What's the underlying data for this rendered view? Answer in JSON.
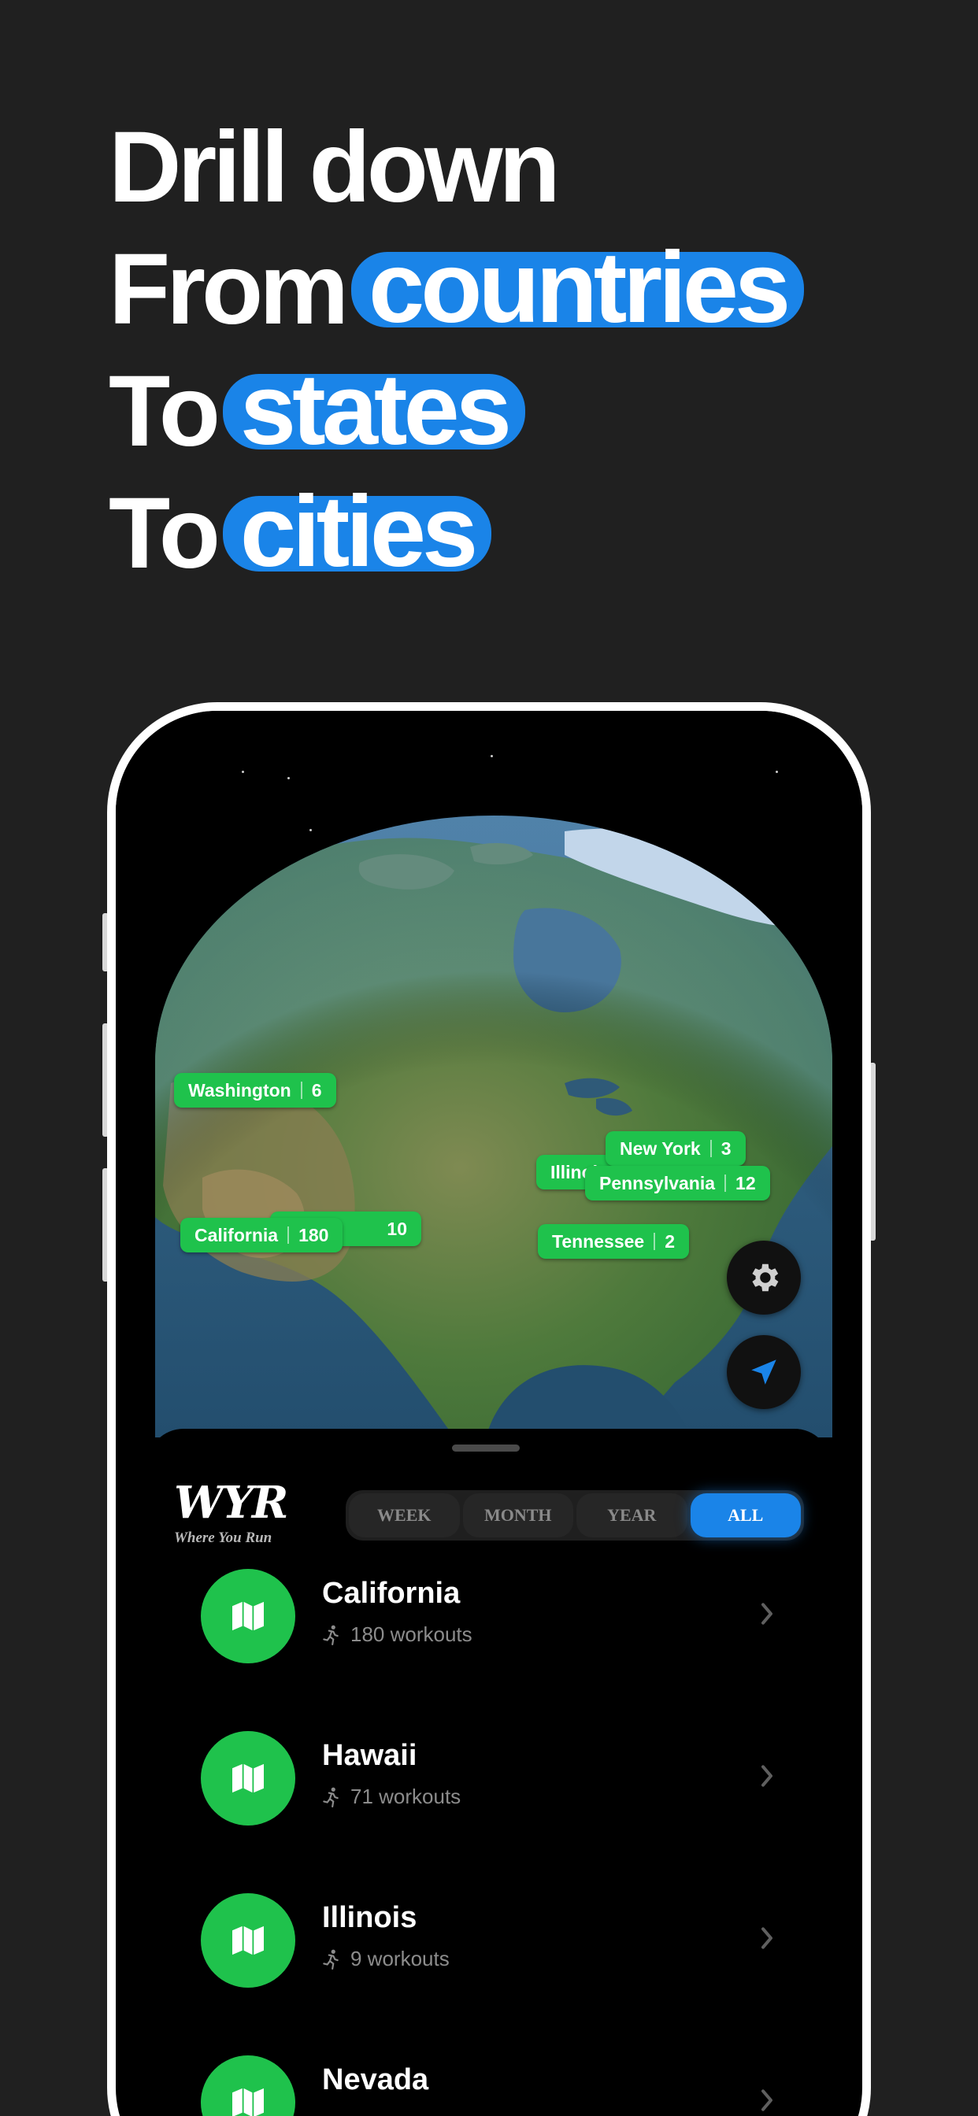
{
  "headline": {
    "line1": "Drill down",
    "line2_prefix": "From",
    "line2_highlight": "countries",
    "line3_prefix": "To",
    "line3_highlight": "states",
    "line4_prefix": "To",
    "line4_highlight": "cities"
  },
  "map_tags": [
    {
      "name": "Washington",
      "count": "6"
    },
    {
      "name": "New York",
      "count": "3"
    },
    {
      "name": "Illinois",
      "count": ""
    },
    {
      "name": "Pennsylvania",
      "count": "12"
    },
    {
      "name": "California",
      "count": "180"
    },
    {
      "name": "",
      "count": "10"
    },
    {
      "name": "Tennessee",
      "count": "2"
    }
  ],
  "app": {
    "logo": "WYR",
    "logo_subtitle": "Where You Run"
  },
  "filter": {
    "options": [
      "WEEK",
      "MONTH",
      "YEAR",
      "ALL"
    ],
    "selected": "ALL"
  },
  "list": [
    {
      "name": "California",
      "workouts": "180 workouts"
    },
    {
      "name": "Hawaii",
      "workouts": "71 workouts"
    },
    {
      "name": "Illinois",
      "workouts": "9 workouts"
    },
    {
      "name": "Nevada",
      "workouts": ""
    }
  ],
  "icons": {
    "settings": "gear-icon",
    "location": "location-arrow-icon",
    "state": "map-icon",
    "runner": "runner-icon",
    "chevron": "chevron-right-icon"
  },
  "colors": {
    "background": "#202020",
    "accent_blue": "#1a84e8",
    "accent_green": "#1fc24c"
  }
}
